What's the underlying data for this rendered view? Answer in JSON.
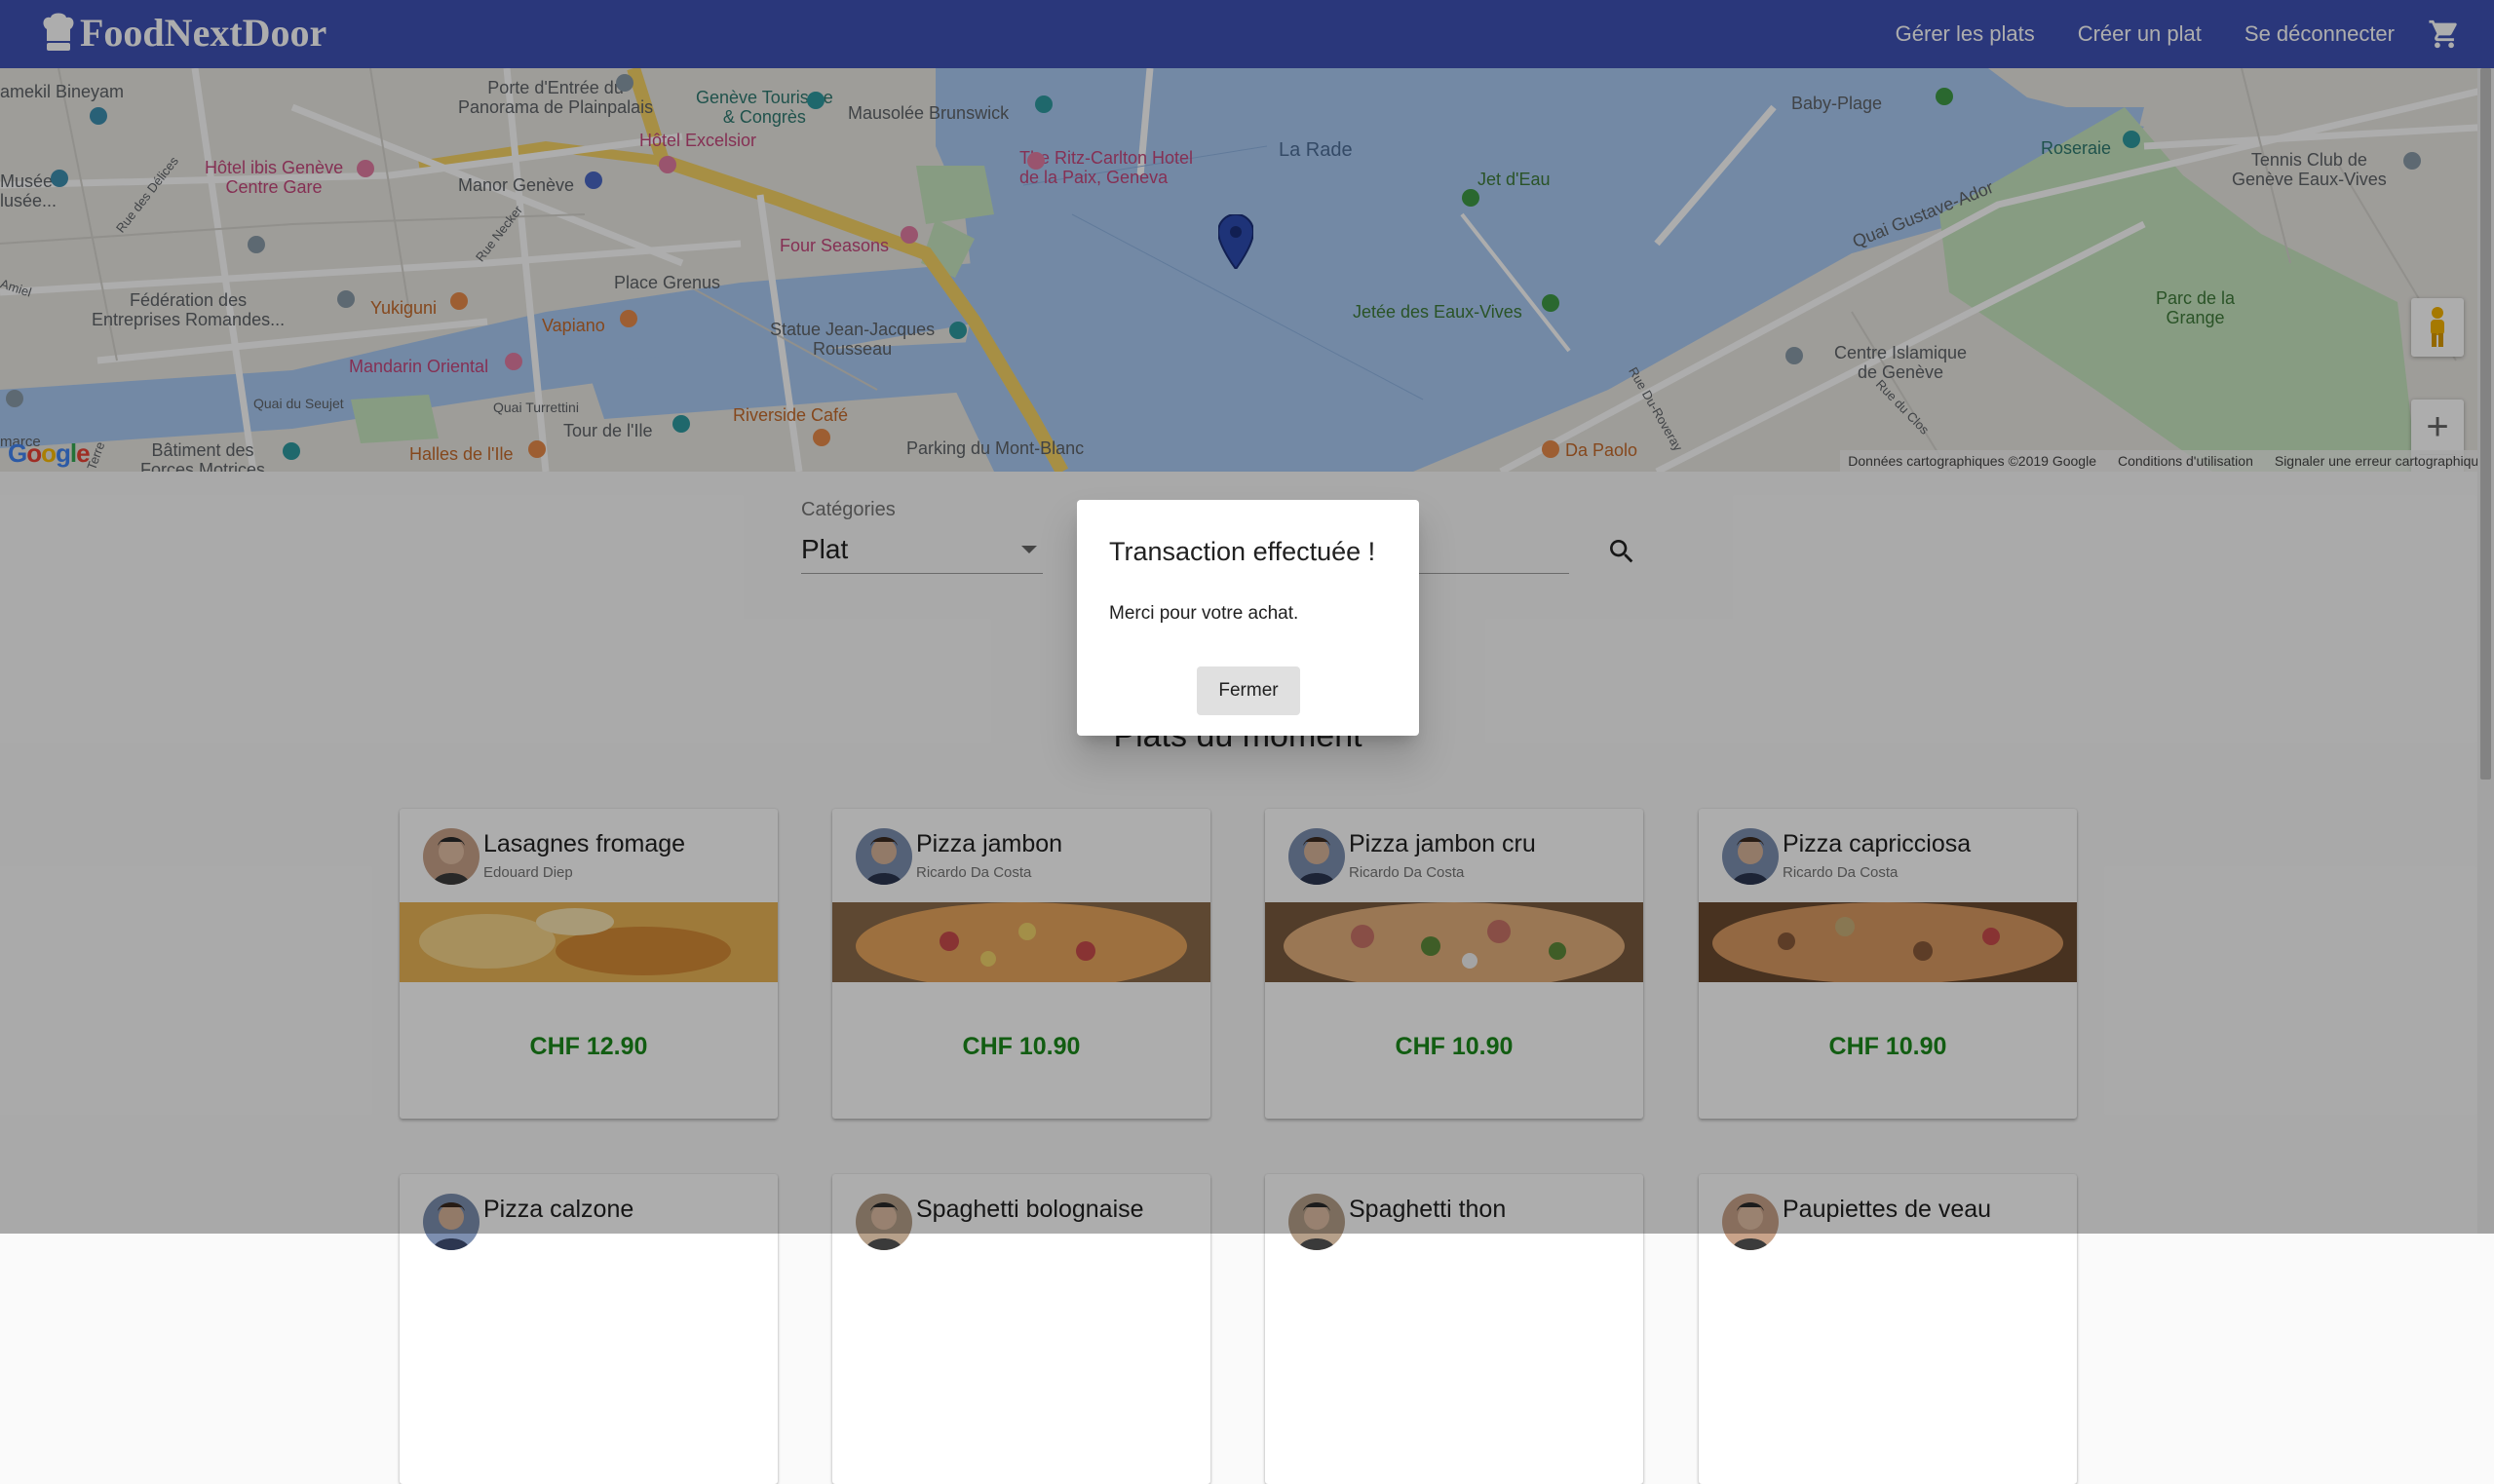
{
  "navbar": {
    "brand": "FoodNextDoor",
    "links": [
      "Gérer les plats",
      "Créer un plat",
      "Se déconnecter"
    ],
    "cart_icon": "shopping-cart-icon",
    "color": "#3f51b5"
  },
  "map": {
    "labels": {
      "water_rade": "La Rade",
      "porte": "Porte d'Entrée du\nPanorama de Plainpalais",
      "geneve_tourisme": "Genève Tourisme\n& Congrès",
      "mausolee": "Mausolée Brunswick",
      "ritz": "The Ritz-Carlton Hotel\nde la Paix, Geneva",
      "excelsior": "Hôtel Excelsior",
      "ibis": "Hôtel ibis Genève\nCentre Gare",
      "manor": "Manor Genève",
      "four_seasons": "Four Seasons",
      "place_grenus": "Place Grenus",
      "federation": "Fédération des\nEntreprises Romandes...",
      "yukiguni": "Yukiguni",
      "vapiano": "Vapiano",
      "statue": "Statue Jean-Jacques\nRousseau",
      "mandarin": "Mandarin Oriental",
      "quai_seujet": "Quai du Seujet",
      "quai_turrettini": "Quai Turrettini",
      "tour_ile": "Tour de l'Ile",
      "riverside": "Riverside Café",
      "batiment": "Bâtiment des\nForces Motrices",
      "halles": "Halles de l'Ile",
      "parking": "Parking du Mont-Blanc",
      "jet_eau": "Jet d'Eau",
      "jetee": "Jetée des Eaux-Vives",
      "baby_plage": "Baby-Plage",
      "roseraie": "Roseraie",
      "tennis": "Tennis Club de\nGenève Eaux-Vives",
      "quai_gustave": "Quai Gustave-Ador",
      "parc_grange": "Parc de la\nGrange",
      "centre_islamique": "Centre Islamique\nde Genève",
      "da_paolo": "Da Paolo",
      "bineyam": "amekil Bineyam",
      "musee": "Musée\nlusée...",
      "rue_delices": "Rue des Délices",
      "rue_necker": "Rue Necker",
      "amiel": "Amiel",
      "rue_du_roveray": "Rue Du-Roveray",
      "rue_clos": "Rue du Clos",
      "terre": "Terre",
      "marche": "marce"
    },
    "google_logo": "Google",
    "attribution": [
      "Données cartographiques ©2019 Google",
      "Conditions d'utilisation",
      "Signaler une erreur cartographique"
    ],
    "zoom_in": "+",
    "zoom_out": "−"
  },
  "filters": {
    "category_label": "Catégories",
    "category_value": "Plat"
  },
  "section_title": "Plats du moment",
  "dishes": [
    {
      "name": "Lasagnes fromage",
      "chef": "Edouard Diep",
      "price": "CHF 12.90"
    },
    {
      "name": "Pizza jambon",
      "chef": "Ricardo Da Costa",
      "price": "CHF 10.90"
    },
    {
      "name": "Pizza jambon cru",
      "chef": "Ricardo Da Costa",
      "price": "CHF 10.90"
    },
    {
      "name": "Pizza capricciosa",
      "chef": "Ricardo Da Costa",
      "price": "CHF 10.90"
    },
    {
      "name": "Pizza calzone",
      "chef": "",
      "price": ""
    },
    {
      "name": "Spaghetti bolognaise",
      "chef": "",
      "price": ""
    },
    {
      "name": "Spaghetti thon",
      "chef": "",
      "price": ""
    },
    {
      "name": "Paupiettes de veau",
      "chef": "",
      "price": ""
    }
  ],
  "dialog": {
    "title": "Transaction effectuée !",
    "message": "Merci pour votre achat.",
    "button": "Fermer"
  },
  "colors": {
    "price": "#1b8a1b",
    "water": "#aacbf4",
    "park": "#c8e6c0"
  }
}
